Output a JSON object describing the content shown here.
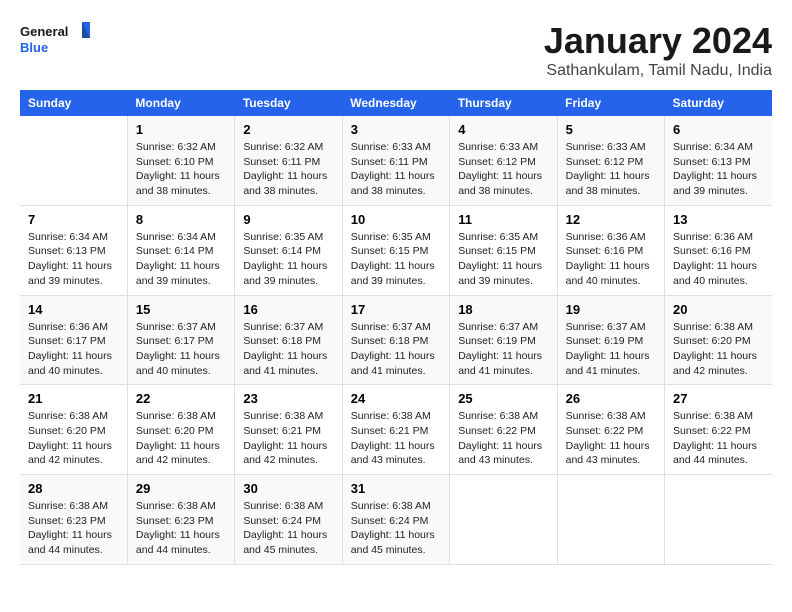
{
  "logo": {
    "line1": "General",
    "line2": "Blue"
  },
  "title": "January 2024",
  "subtitle": "Sathankulam, Tamil Nadu, India",
  "days_of_week": [
    "Sunday",
    "Monday",
    "Tuesday",
    "Wednesday",
    "Thursday",
    "Friday",
    "Saturday"
  ],
  "weeks": [
    [
      {
        "day": "",
        "info": ""
      },
      {
        "day": "1",
        "info": "Sunrise: 6:32 AM\nSunset: 6:10 PM\nDaylight: 11 hours\nand 38 minutes."
      },
      {
        "day": "2",
        "info": "Sunrise: 6:32 AM\nSunset: 6:11 PM\nDaylight: 11 hours\nand 38 minutes."
      },
      {
        "day": "3",
        "info": "Sunrise: 6:33 AM\nSunset: 6:11 PM\nDaylight: 11 hours\nand 38 minutes."
      },
      {
        "day": "4",
        "info": "Sunrise: 6:33 AM\nSunset: 6:12 PM\nDaylight: 11 hours\nand 38 minutes."
      },
      {
        "day": "5",
        "info": "Sunrise: 6:33 AM\nSunset: 6:12 PM\nDaylight: 11 hours\nand 38 minutes."
      },
      {
        "day": "6",
        "info": "Sunrise: 6:34 AM\nSunset: 6:13 PM\nDaylight: 11 hours\nand 39 minutes."
      }
    ],
    [
      {
        "day": "7",
        "info": "Sunrise: 6:34 AM\nSunset: 6:13 PM\nDaylight: 11 hours\nand 39 minutes."
      },
      {
        "day": "8",
        "info": "Sunrise: 6:34 AM\nSunset: 6:14 PM\nDaylight: 11 hours\nand 39 minutes."
      },
      {
        "day": "9",
        "info": "Sunrise: 6:35 AM\nSunset: 6:14 PM\nDaylight: 11 hours\nand 39 minutes."
      },
      {
        "day": "10",
        "info": "Sunrise: 6:35 AM\nSunset: 6:15 PM\nDaylight: 11 hours\nand 39 minutes."
      },
      {
        "day": "11",
        "info": "Sunrise: 6:35 AM\nSunset: 6:15 PM\nDaylight: 11 hours\nand 39 minutes."
      },
      {
        "day": "12",
        "info": "Sunrise: 6:36 AM\nSunset: 6:16 PM\nDaylight: 11 hours\nand 40 minutes."
      },
      {
        "day": "13",
        "info": "Sunrise: 6:36 AM\nSunset: 6:16 PM\nDaylight: 11 hours\nand 40 minutes."
      }
    ],
    [
      {
        "day": "14",
        "info": "Sunrise: 6:36 AM\nSunset: 6:17 PM\nDaylight: 11 hours\nand 40 minutes."
      },
      {
        "day": "15",
        "info": "Sunrise: 6:37 AM\nSunset: 6:17 PM\nDaylight: 11 hours\nand 40 minutes."
      },
      {
        "day": "16",
        "info": "Sunrise: 6:37 AM\nSunset: 6:18 PM\nDaylight: 11 hours\nand 41 minutes."
      },
      {
        "day": "17",
        "info": "Sunrise: 6:37 AM\nSunset: 6:18 PM\nDaylight: 11 hours\nand 41 minutes."
      },
      {
        "day": "18",
        "info": "Sunrise: 6:37 AM\nSunset: 6:19 PM\nDaylight: 11 hours\nand 41 minutes."
      },
      {
        "day": "19",
        "info": "Sunrise: 6:37 AM\nSunset: 6:19 PM\nDaylight: 11 hours\nand 41 minutes."
      },
      {
        "day": "20",
        "info": "Sunrise: 6:38 AM\nSunset: 6:20 PM\nDaylight: 11 hours\nand 42 minutes."
      }
    ],
    [
      {
        "day": "21",
        "info": "Sunrise: 6:38 AM\nSunset: 6:20 PM\nDaylight: 11 hours\nand 42 minutes."
      },
      {
        "day": "22",
        "info": "Sunrise: 6:38 AM\nSunset: 6:20 PM\nDaylight: 11 hours\nand 42 minutes."
      },
      {
        "day": "23",
        "info": "Sunrise: 6:38 AM\nSunset: 6:21 PM\nDaylight: 11 hours\nand 42 minutes."
      },
      {
        "day": "24",
        "info": "Sunrise: 6:38 AM\nSunset: 6:21 PM\nDaylight: 11 hours\nand 43 minutes."
      },
      {
        "day": "25",
        "info": "Sunrise: 6:38 AM\nSunset: 6:22 PM\nDaylight: 11 hours\nand 43 minutes."
      },
      {
        "day": "26",
        "info": "Sunrise: 6:38 AM\nSunset: 6:22 PM\nDaylight: 11 hours\nand 43 minutes."
      },
      {
        "day": "27",
        "info": "Sunrise: 6:38 AM\nSunset: 6:22 PM\nDaylight: 11 hours\nand 44 minutes."
      }
    ],
    [
      {
        "day": "28",
        "info": "Sunrise: 6:38 AM\nSunset: 6:23 PM\nDaylight: 11 hours\nand 44 minutes."
      },
      {
        "day": "29",
        "info": "Sunrise: 6:38 AM\nSunset: 6:23 PM\nDaylight: 11 hours\nand 44 minutes."
      },
      {
        "day": "30",
        "info": "Sunrise: 6:38 AM\nSunset: 6:24 PM\nDaylight: 11 hours\nand 45 minutes."
      },
      {
        "day": "31",
        "info": "Sunrise: 6:38 AM\nSunset: 6:24 PM\nDaylight: 11 hours\nand 45 minutes."
      },
      {
        "day": "",
        "info": ""
      },
      {
        "day": "",
        "info": ""
      },
      {
        "day": "",
        "info": ""
      }
    ]
  ]
}
